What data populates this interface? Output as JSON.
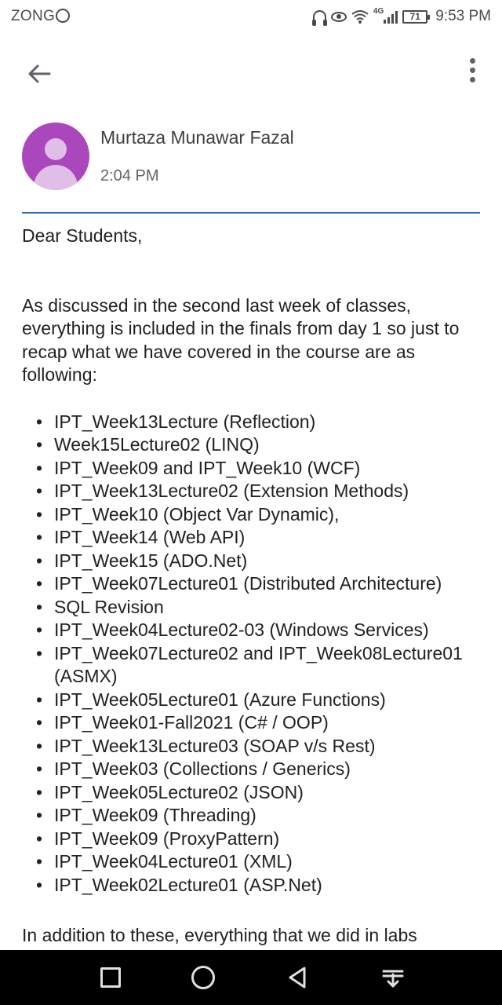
{
  "status_bar": {
    "carrier": "ZONG",
    "network_type": "4G",
    "battery": "71",
    "time": "9:53 PM",
    "icons": [
      "whatsapp-icon",
      "headset-icon",
      "eye-icon",
      "wifi-icon",
      "signal-icon",
      "battery-icon"
    ]
  },
  "toolbar": {
    "back_icon": "arrow-back-icon",
    "more_icon": "more-vertical-icon"
  },
  "email": {
    "sender": "Murtaza Munawar Fazal",
    "time": "2:04 PM",
    "avatar_color": "#ab47bc",
    "accent_color": "#2a6bb3",
    "greeting": "Dear Students,",
    "intro": "As discussed in the second last week of classes, everything is included in the finals from day 1 so just to recap what we have covered in the course are as following:",
    "topics": [
      "IPT_Week13Lecture (Reflection)",
      "Week15Lecture02 (LINQ)",
      "IPT_Week09 and IPT_Week10  (WCF)",
      "IPT_Week13Lecture02 (Extension Methods)",
      "IPT_Week10 (Object Var Dynamic),",
      "IPT_Week14 (Web API)",
      "IPT_Week15 (ADO.Net)",
      "IPT_Week07Lecture01 (Distributed Architecture)",
      "SQL Revision",
      "IPT_Week04Lecture02-03 (Windows Services)",
      "IPT_Week07Lecture02 and IPT_Week08Lecture01 (ASMX)",
      "IPT_Week05Lecture01 (Azure Functions)",
      "IPT_Week01-Fall2021 (C# / OOP)",
      "IPT_Week13Lecture03 (SOAP v/s Rest)",
      "IPT_Week03 (Collections / Generics)",
      "IPT_Week05Lecture02 (JSON)",
      "IPT_Week09 (Threading)",
      "IPT_Week09 (ProxyPattern)",
      "IPT_Week04Lecture01 (XML)",
      "IPT_Week02Lecture01 (ASP.Net)"
    ],
    "cut_off_text": "In addition to these, everything that we did in labs"
  },
  "nav_bar": {
    "icons": [
      "recent-apps-icon",
      "home-icon",
      "back-icon",
      "notifications-pull-icon"
    ]
  }
}
